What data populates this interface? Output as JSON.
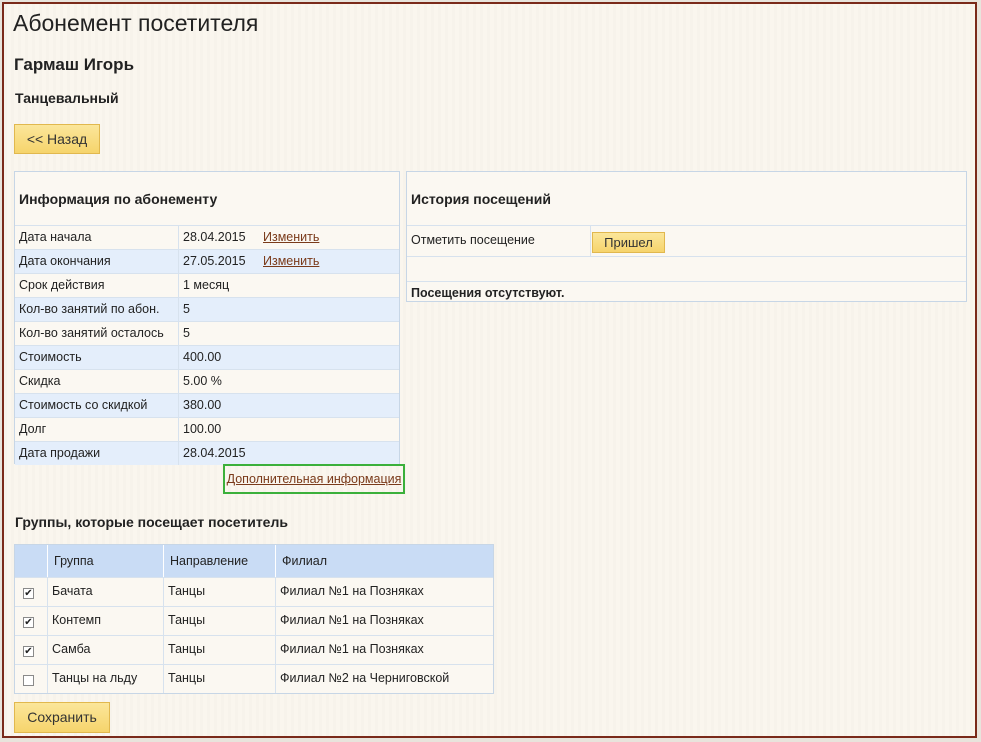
{
  "page": {
    "title": "Абонемент посетителя",
    "client_name": "Гармаш Игорь",
    "subscription_type": "Танцевальный"
  },
  "back_button": "<< Назад",
  "info": {
    "title": "Информация по абонементу",
    "edit_label": "Изменить",
    "rows": [
      {
        "label": "Дата начала",
        "value": "28.04.2015"
      },
      {
        "label": "Дата окончания",
        "value": "27.05.2015"
      },
      {
        "label": "Срок действия",
        "value": "1 месяц"
      },
      {
        "label": "Кол-во занятий по абон.",
        "value": "5"
      },
      {
        "label": "Кол-во занятий осталось",
        "value": "5"
      },
      {
        "label": "Стоимость",
        "value": "400.00"
      },
      {
        "label": "Скидка",
        "value": "5.00 %"
      },
      {
        "label": "Стоимость со скидкой",
        "value": "380.00"
      },
      {
        "label": "Долг",
        "value": "100.00"
      },
      {
        "label": "Дата продажи",
        "value": "28.04.2015"
      }
    ],
    "more_link": "Дополнительная информация"
  },
  "history": {
    "title": "История посещений",
    "mark_label": "Отметить посещение",
    "came_button": "Пришел",
    "empty_text": "Посещения отсутствуют."
  },
  "groups": {
    "title": "Группы, которые посещает посетитель",
    "headers": [
      "Группа",
      "Направление",
      "Филиал"
    ],
    "rows": [
      {
        "checked": true,
        "group": "Бачата",
        "direction": "Танцы",
        "branch": "Филиал №1 на Позняках"
      },
      {
        "checked": true,
        "group": "Контемп",
        "direction": "Танцы",
        "branch": "Филиал №1 на Позняках"
      },
      {
        "checked": true,
        "group": "Самба",
        "direction": "Танцы",
        "branch": "Филиал №1 на Позняках"
      },
      {
        "checked": false,
        "group": "Танцы на льду",
        "direction": "Танцы",
        "branch": "Филиал №2 на Черниговской"
      }
    ]
  },
  "save_button": "Сохранить",
  "colors": {
    "accent_button": "#f6d46c",
    "row_alt": "#e4eefb",
    "header": "#c9dcf5",
    "link": "#7a3a1a",
    "highlight": "#3bb03b"
  }
}
